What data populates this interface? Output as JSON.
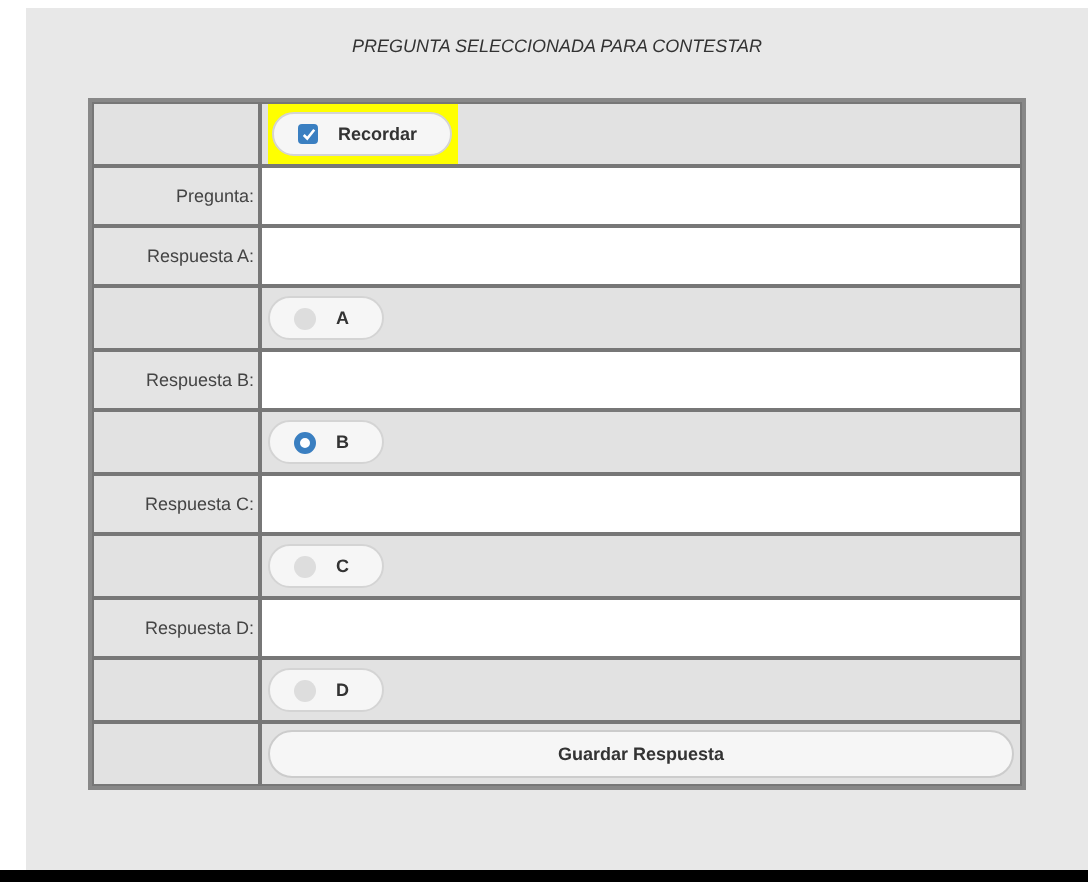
{
  "title": "PREGUNTA SELECCIONADA PARA CONTESTAR",
  "rows": [
    {
      "kind": "checkbox",
      "label": "Recordar",
      "checked": true,
      "highlighted": true
    },
    {
      "kind": "field",
      "label": "Pregunta:"
    },
    {
      "kind": "field",
      "label": "Respuesta A:"
    },
    {
      "kind": "radio",
      "label": "A",
      "selected": false
    },
    {
      "kind": "field",
      "label": "Respuesta B:"
    },
    {
      "kind": "radio",
      "label": "B",
      "selected": true
    },
    {
      "kind": "field",
      "label": "Respuesta C:"
    },
    {
      "kind": "radio",
      "label": "C",
      "selected": false
    },
    {
      "kind": "field",
      "label": "Respuesta D:"
    },
    {
      "kind": "radio",
      "label": "D",
      "selected": false
    },
    {
      "kind": "button",
      "label": "Guardar Respuesta"
    }
  ]
}
